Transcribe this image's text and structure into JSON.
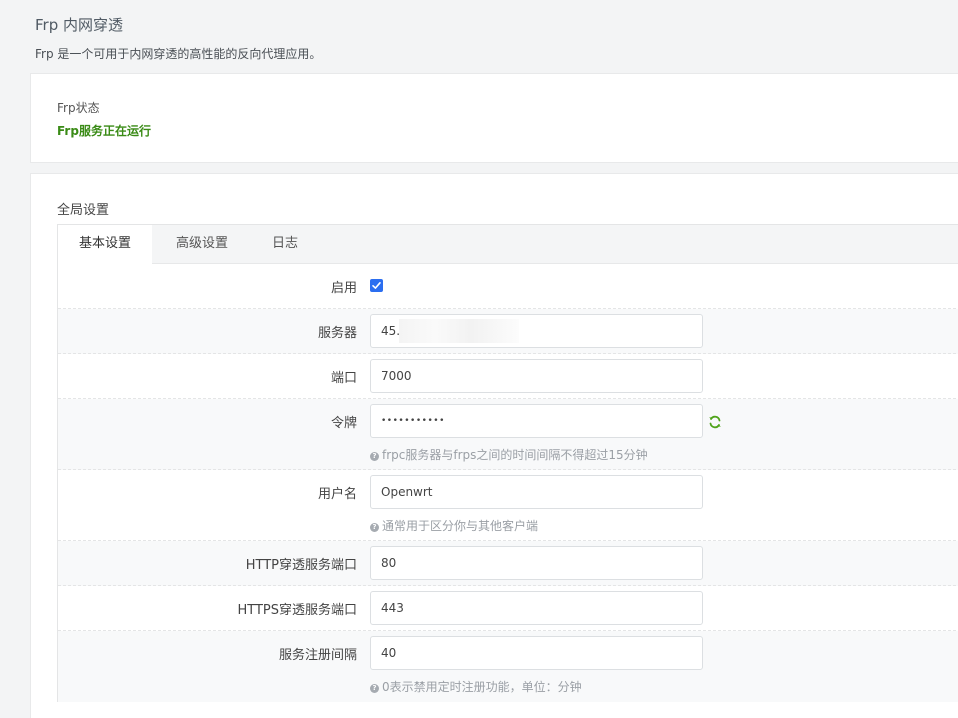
{
  "page": {
    "title": "Frp 内网穿透",
    "description": "Frp 是一个可用于内网穿透的高性能的反向代理应用。"
  },
  "status": {
    "label": "Frp状态",
    "value": "Frp服务正在运行",
    "value_color": "#3a8b16"
  },
  "settings": {
    "title": "全局设置",
    "tabs": [
      {
        "label": "基本设置",
        "active": true
      },
      {
        "label": "高级设置",
        "active": false
      },
      {
        "label": "日志",
        "active": false
      }
    ],
    "fields": {
      "enable": {
        "label": "启用",
        "checked": true
      },
      "server": {
        "label": "服务器",
        "value": "45."
      },
      "port": {
        "label": "端口",
        "value": "7000"
      },
      "token": {
        "label": "令牌",
        "value": "•••••••••••",
        "help": "frpc服务器与frps之间的时间间隔不得超过15分钟"
      },
      "username": {
        "label": "用户名",
        "value": "Openwrt",
        "help": "通常用于区分你与其他客户端"
      },
      "http_port": {
        "label": "HTTP穿透服务端口",
        "value": "80"
      },
      "https_port": {
        "label": "HTTPS穿透服务端口",
        "value": "443"
      },
      "register_interval": {
        "label": "服务注册间隔",
        "value": "40",
        "help": "0表示禁用定时注册功能，单位：分钟"
      }
    }
  },
  "colors": {
    "accent": "#2b6ef0",
    "status_green": "#3a8b16",
    "reveal_icon": "#4fa31a"
  },
  "icons": {
    "help": "question-circle-icon",
    "reveal": "refresh-reveal-icon",
    "checkbox": "check-icon"
  }
}
